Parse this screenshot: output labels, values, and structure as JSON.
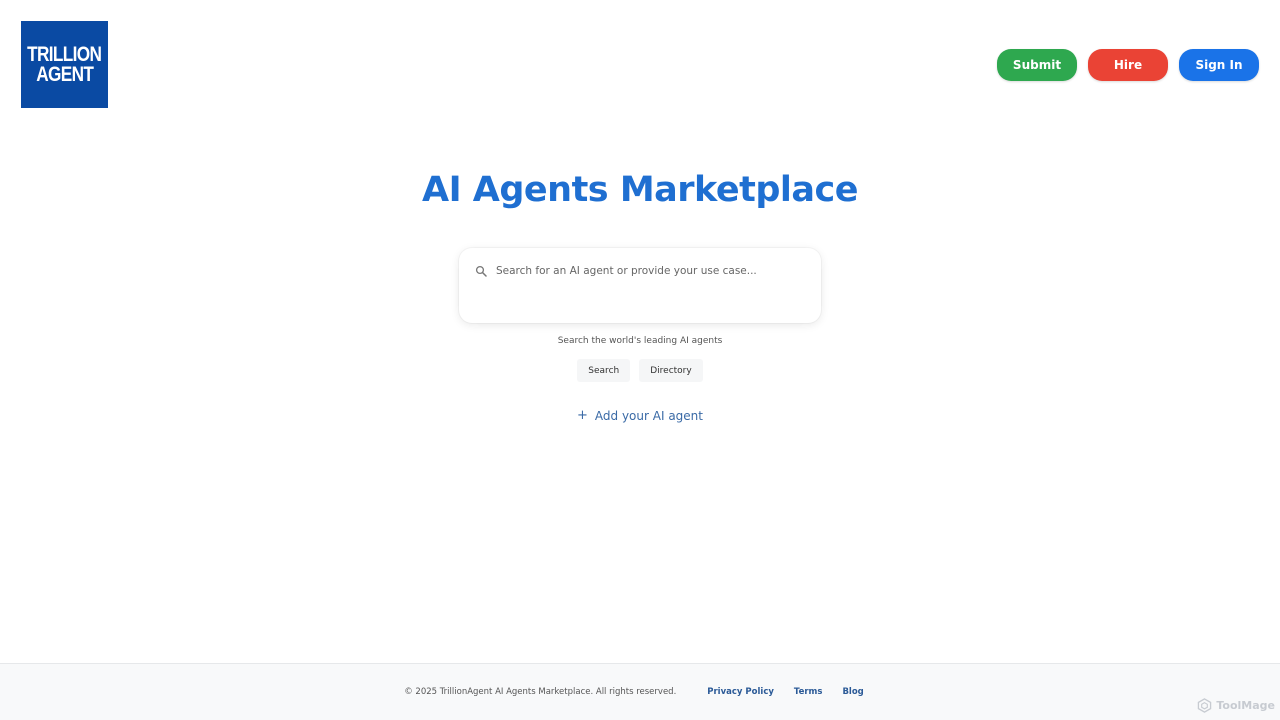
{
  "logo": {
    "line1": "TRILLION",
    "line2": "AGENT",
    "bg_color": "#0a4aa3"
  },
  "header": {
    "buttons": [
      {
        "label": "Submit",
        "color": "#2ea84f"
      },
      {
        "label": "Hire",
        "color": "#ea4335"
      },
      {
        "label": "Sign In",
        "color": "#1a73e8"
      }
    ]
  },
  "hero": {
    "title": "AI Agents Marketplace",
    "title_color": "#1f6fd1"
  },
  "search": {
    "placeholder": "Search for an AI agent or provide your use case...",
    "value": "",
    "icon": "search-icon"
  },
  "tagline": "Search the world's leading AI agents",
  "mode_tabs": [
    "Search",
    "Directory"
  ],
  "add_agent": {
    "icon": "plus-icon",
    "label": "Add your AI agent"
  },
  "footer": {
    "copyright": "© 2025 TrillionAgent AI Agents Marketplace. All rights reserved.",
    "links": [
      "Privacy Policy",
      "Terms",
      "Blog"
    ]
  },
  "watermark": {
    "label": "ToolMage",
    "icon": "toolmage-logo-icon"
  }
}
